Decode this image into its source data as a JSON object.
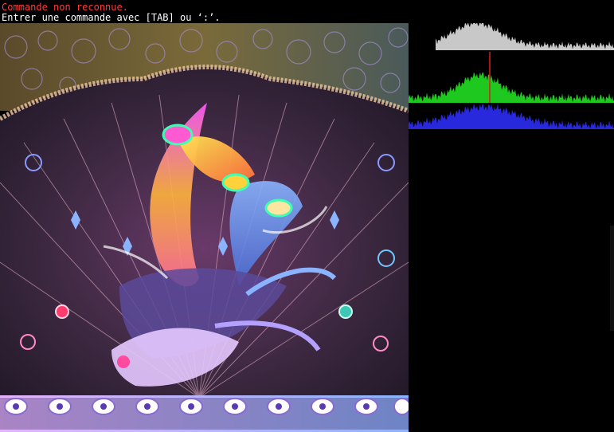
{
  "window": {
    "background": "#000000"
  },
  "status": {
    "error": "Commande non reconnue.",
    "hint": "Entrer une commande avec [TAB] ou ‘:’.",
    "error_color": "#ff3b3b",
    "hint_color": "#ffffff"
  },
  "image": {
    "subject": "phoenix-batik-illustration",
    "palette": [
      "#c8b4ff",
      "#ff6ee6",
      "#ffd23c",
      "#6ea0ff",
      "#3a2a4a"
    ]
  },
  "histogram": {
    "channels": [
      {
        "name": "luminance",
        "color": "#c8c8c8"
      },
      {
        "name": "green",
        "color": "#1ec81e"
      },
      {
        "name": "blue",
        "color": "#2828dc"
      }
    ],
    "marker_color": "#dc1e1e"
  }
}
